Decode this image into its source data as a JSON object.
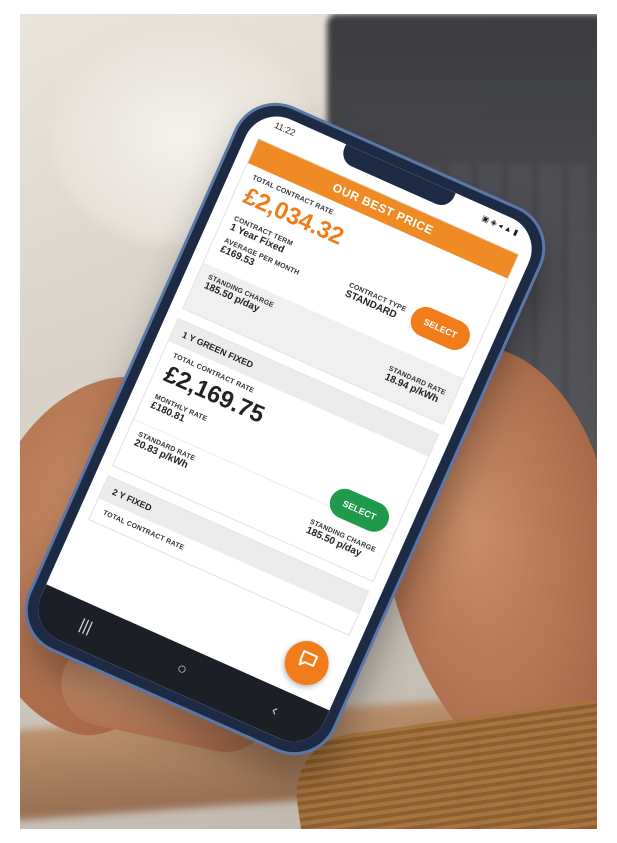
{
  "status": {
    "time": "11:22",
    "icons": "◌ ◌ ■",
    "right_icons": "▣ ◈ ◂ ▲ ▮"
  },
  "best_price": {
    "header": "OUR BEST PRICE",
    "total_label": "TOTAL CONTRACT RATE",
    "total": "£2,034.32",
    "term_label": "CONTRACT TERM",
    "term": "1 Year Fixed",
    "type_label": "CONTRACT TYPE",
    "type": "STANDARD",
    "avg_label": "AVERAGE PER MONTH",
    "avg": "£169.53",
    "select": "SELECT",
    "standing_label": "STANDING CHARGE",
    "standing": "185.50 p/day",
    "standard_label": "STANDARD RATE",
    "standard": "18.94 p/kWh"
  },
  "green_plan": {
    "header": "1 Y GREEN FIXED",
    "total_label": "TOTAL CONTRACT RATE",
    "total": "£2,169.75",
    "monthly_label": "MONTHLY RATE",
    "monthly": "£180.81",
    "select": "SELECT",
    "standard_label": "STANDARD RATE",
    "standard": "20.83 p/kWh",
    "standing_label": "STANDING CHARGE",
    "standing": "185.50 p/day"
  },
  "two_year_plan": {
    "header": "2 Y FIXED",
    "total_label": "TOTAL CONTRACT RATE"
  },
  "nav": {
    "recent": "|||",
    "home": "○",
    "back": "‹"
  },
  "colors": {
    "accent": "#f07c1a",
    "green": "#1f9a4a"
  },
  "icons": {
    "chat": "chat-bubble-icon"
  }
}
